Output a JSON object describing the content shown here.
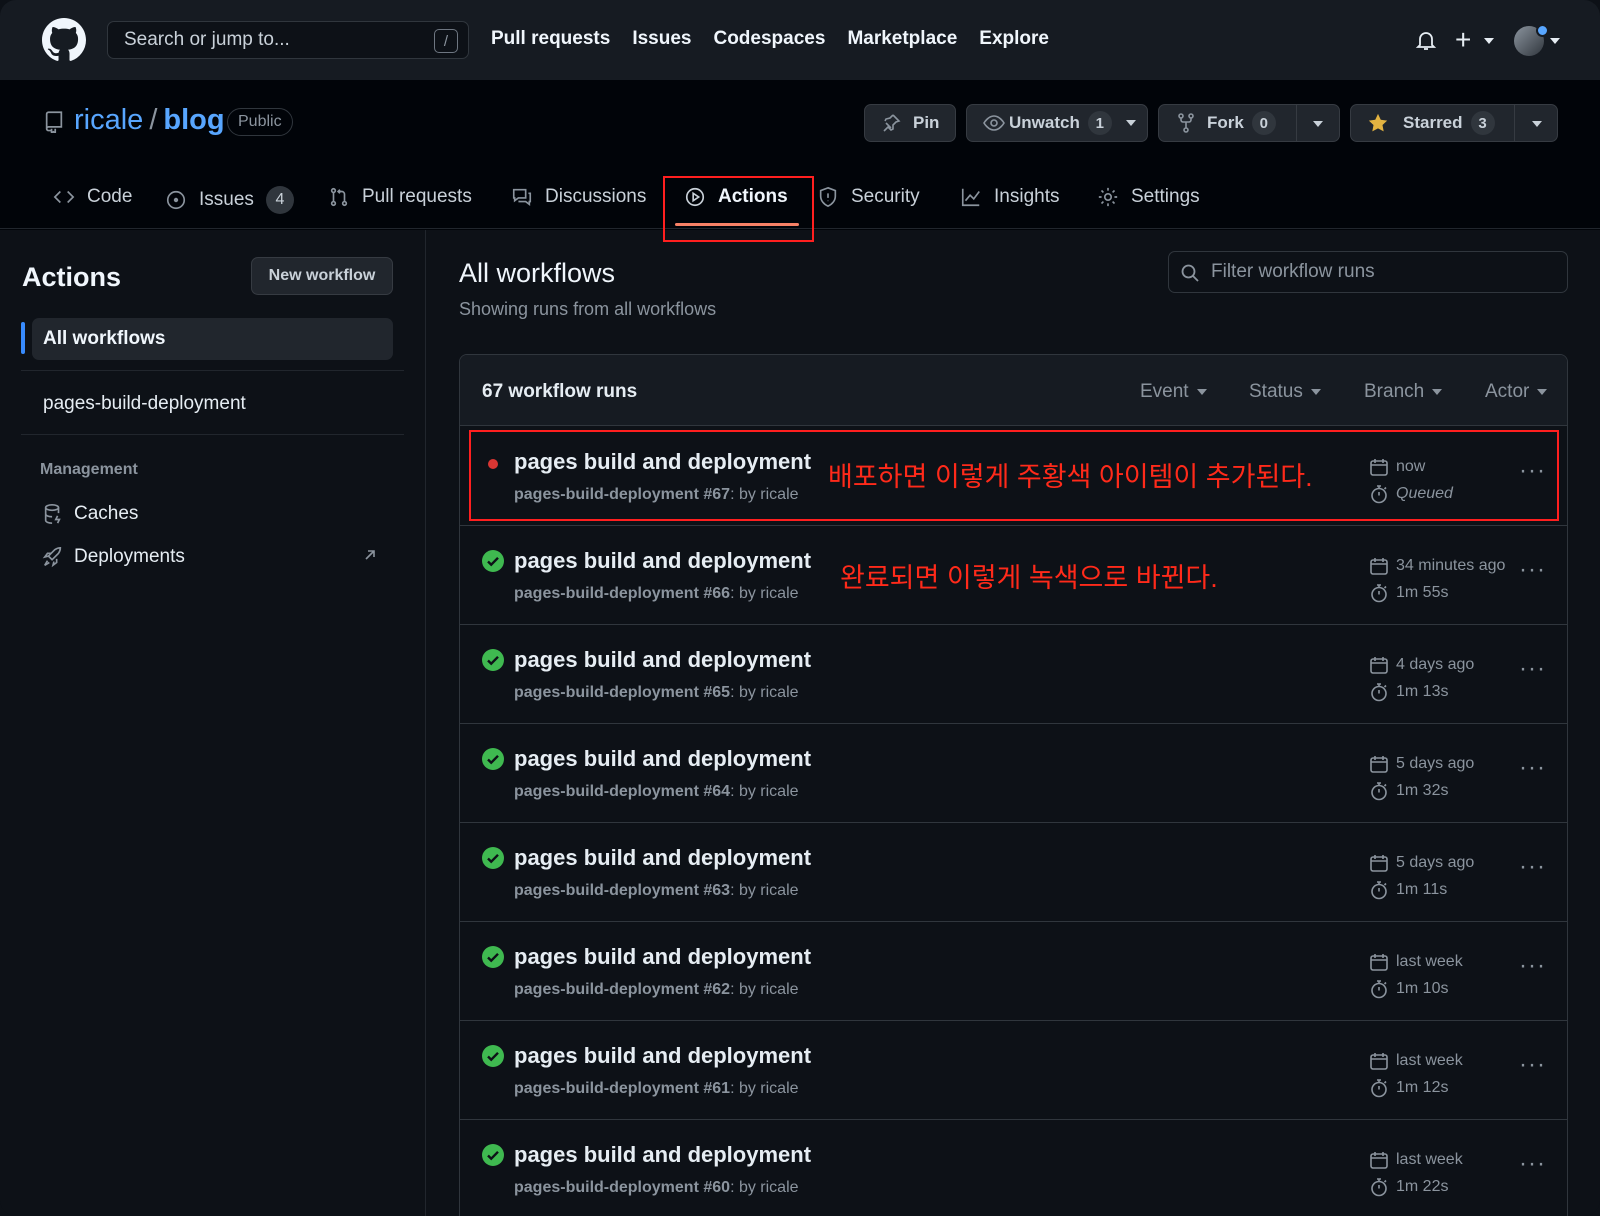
{
  "header": {
    "search_placeholder": "Search or jump to...",
    "search_shortcut": "/",
    "nav": [
      "Pull requests",
      "Issues",
      "Codespaces",
      "Marketplace",
      "Explore"
    ]
  },
  "repo": {
    "owner": "ricale",
    "slash": "/",
    "name": "blog",
    "visibility": "Public",
    "pin_label": "Pin",
    "watch_label": "Unwatch",
    "watch_count": "1",
    "fork_label": "Fork",
    "fork_count": "0",
    "star_label": "Starred",
    "star_count": "3"
  },
  "tabs": [
    {
      "label": "Code",
      "icon": "code-icon"
    },
    {
      "label": "Issues",
      "icon": "issue-icon",
      "count": "4"
    },
    {
      "label": "Pull requests",
      "icon": "pull-request-icon"
    },
    {
      "label": "Discussions",
      "icon": "discussion-icon"
    },
    {
      "label": "Actions",
      "icon": "play-icon",
      "selected": true
    },
    {
      "label": "Security",
      "icon": "shield-icon"
    },
    {
      "label": "Insights",
      "icon": "graph-icon"
    },
    {
      "label": "Settings",
      "icon": "gear-icon"
    }
  ],
  "sidebar": {
    "title": "Actions",
    "new_workflow": "New workflow",
    "all_workflows": "All workflows",
    "workflows": [
      "pages-build-deployment"
    ],
    "management_heading": "Management",
    "management": [
      {
        "label": "Caches",
        "icon": "database-icon"
      },
      {
        "label": "Deployments",
        "icon": "rocket-icon"
      }
    ]
  },
  "main": {
    "title": "All workflows",
    "subtitle": "Showing runs from all workflows",
    "filter_placeholder": "Filter workflow runs",
    "runs_count": "67 workflow runs",
    "filters": [
      "Event",
      "Status",
      "Branch",
      "Actor"
    ],
    "runs": [
      {
        "status": "queued",
        "title": "pages build and deployment",
        "workflow": "pages-build-deployment",
        "number": "#67",
        "by": ": by ricale",
        "date": "now",
        "duration": "Queued",
        "annotation": "배포하면 이렇게 주황색 아이템이 추가된다."
      },
      {
        "status": "success",
        "title": "pages build and deployment",
        "workflow": "pages-build-deployment",
        "number": "#66",
        "by": ": by ricale",
        "date": "34 minutes ago",
        "duration": "1m 55s",
        "annotation": "완료되면 이렇게 녹색으로 바뀐다."
      },
      {
        "status": "success",
        "title": "pages build and deployment",
        "workflow": "pages-build-deployment",
        "number": "#65",
        "by": ": by ricale",
        "date": "4 days ago",
        "duration": "1m 13s"
      },
      {
        "status": "success",
        "title": "pages build and deployment",
        "workflow": "pages-build-deployment",
        "number": "#64",
        "by": ": by ricale",
        "date": "5 days ago",
        "duration": "1m 32s"
      },
      {
        "status": "success",
        "title": "pages build and deployment",
        "workflow": "pages-build-deployment",
        "number": "#63",
        "by": ": by ricale",
        "date": "5 days ago",
        "duration": "1m 11s"
      },
      {
        "status": "success",
        "title": "pages build and deployment",
        "workflow": "pages-build-deployment",
        "number": "#62",
        "by": ": by ricale",
        "date": "last week",
        "duration": "1m 10s"
      },
      {
        "status": "success",
        "title": "pages build and deployment",
        "workflow": "pages-build-deployment",
        "number": "#61",
        "by": ": by ricale",
        "date": "last week",
        "duration": "1m 12s"
      },
      {
        "status": "success",
        "title": "pages build and deployment",
        "workflow": "pages-build-deployment",
        "number": "#60",
        "by": ": by ricale",
        "date": "last week",
        "duration": "1m 22s"
      }
    ]
  },
  "colors": {
    "accent_blue": "#58a6ff",
    "success_green": "#3fb950",
    "queued_red": "#da3633",
    "annotation_red": "#ff2a1a",
    "tab_underline": "#f78166",
    "star": "#e3b341"
  }
}
